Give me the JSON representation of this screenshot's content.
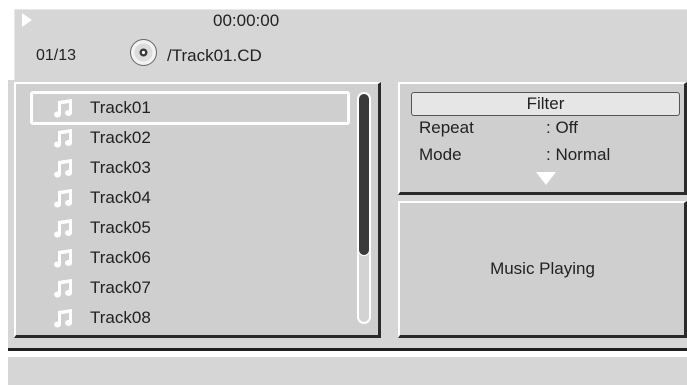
{
  "header": {
    "time": "00:00:00",
    "counter": "01/13",
    "path": "/Track01.CD",
    "play_icon": "play-icon",
    "disc_icon": "disc-icon"
  },
  "tracks": [
    "Track01",
    "Track02",
    "Track03",
    "Track04",
    "Track05",
    "Track06",
    "Track07",
    "Track08"
  ],
  "filter": {
    "button_label": "Filter",
    "repeat_label": "Repeat",
    "repeat_value": ": Off",
    "mode_label": "Mode",
    "mode_value": ": Normal"
  },
  "status": {
    "text": "Music Playing"
  },
  "colors": {
    "panel": "#cfcfcf",
    "highlight": "#ffffff",
    "shadow": "#2a2a2a"
  }
}
